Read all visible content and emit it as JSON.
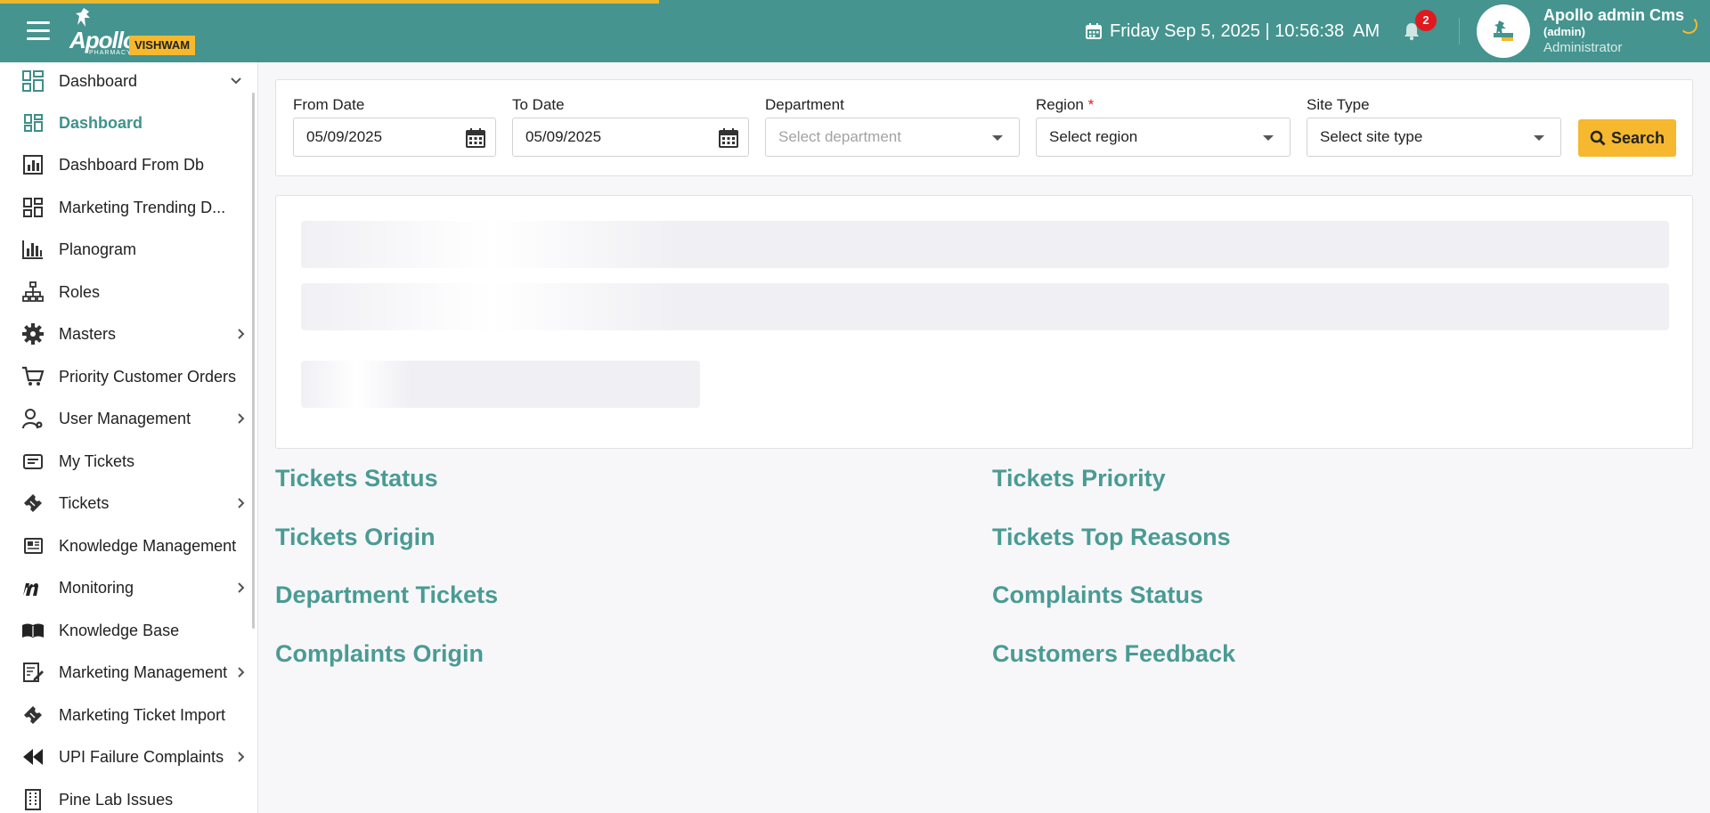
{
  "header": {
    "brand": "Apollo",
    "brand_sub": "PHARMACY",
    "brand_badge": "VISHWAM",
    "datetime": "Friday Sep 5, 2025 | 10:56:38  AM",
    "notification_count": "2",
    "user": {
      "name": "Apollo admin Cms",
      "login": "(admin)",
      "role": "Administrator"
    },
    "colors": {
      "bar": "#45948f",
      "accent": "#f5b82e",
      "badge": "#e0191f"
    }
  },
  "sidebar": {
    "items": [
      {
        "label": "Dashboard",
        "icon": "dashboard-grid-icon",
        "expand": "down"
      },
      {
        "label": "Dashboard",
        "icon": "dashboard-grid-icon",
        "active": true
      },
      {
        "label": "Dashboard From Db",
        "icon": "bar-chart-icon"
      },
      {
        "label": "Marketing Trending D...",
        "icon": "dashboard-grid-icon"
      },
      {
        "label": "Planogram",
        "icon": "bar-chart-icon"
      },
      {
        "label": "Roles",
        "icon": "sitemap-icon"
      },
      {
        "label": "Masters",
        "icon": "gear-icon",
        "expand": "right"
      },
      {
        "label": "Priority Customer Orders",
        "icon": "cart-icon"
      },
      {
        "label": "User Management",
        "icon": "user-gear-icon",
        "expand": "right"
      },
      {
        "label": "My Tickets",
        "icon": "ticket-list-icon"
      },
      {
        "label": "Tickets",
        "icon": "ticket-icon",
        "expand": "right"
      },
      {
        "label": "Knowledge Management",
        "icon": "newspaper-icon"
      },
      {
        "label": "Monitoring",
        "icon": "monitoring-m-icon",
        "expand": "right"
      },
      {
        "label": "Knowledge Base",
        "icon": "open-book-icon"
      },
      {
        "label": "Marketing Management",
        "icon": "edit-doc-icon",
        "expand": "right"
      },
      {
        "label": "Marketing Ticket Import",
        "icon": "ticket-icon"
      },
      {
        "label": "UPI Failure Complaints",
        "icon": "backward-icon",
        "expand": "right"
      },
      {
        "label": "Pine Lab Issues",
        "icon": "building-icon"
      }
    ]
  },
  "filters": {
    "from_date": {
      "label": "From Date",
      "value": "05/09/2025"
    },
    "to_date": {
      "label": "To Date",
      "value": "05/09/2025"
    },
    "department": {
      "label": "Department",
      "placeholder": "Select department"
    },
    "region": {
      "label": "Region",
      "required_mark": "*",
      "placeholder": "Select region"
    },
    "site_type": {
      "label": "Site Type",
      "placeholder": "Select site type"
    },
    "search_label": "Search"
  },
  "sections": {
    "left": [
      "Tickets Status",
      "Tickets Origin",
      "Department Tickets",
      "Complaints Origin"
    ],
    "right": [
      "Tickets Priority",
      "Tickets Top Reasons",
      "Complaints Status",
      "Customers Feedback"
    ]
  }
}
